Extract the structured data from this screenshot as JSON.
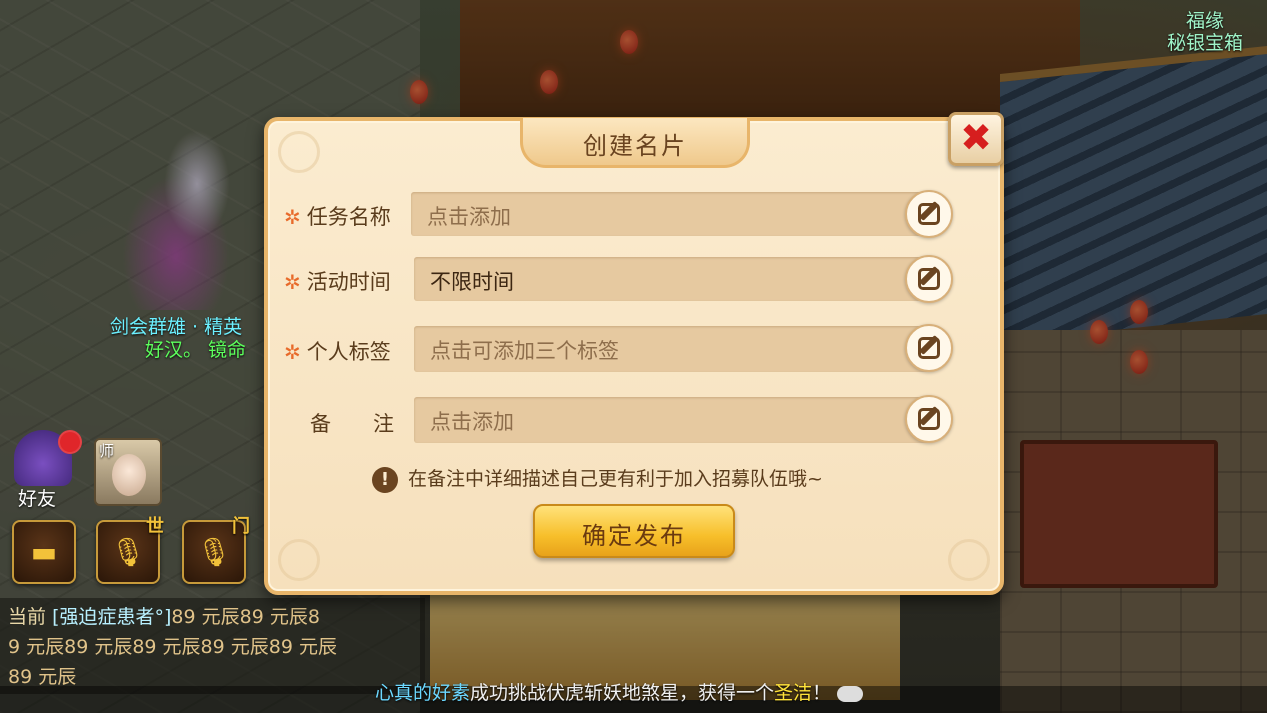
{
  "hud": {
    "top_right_line1": "福缘",
    "top_right_line2": "秘银宝箱",
    "player_name": "剑会群雄 · 精英",
    "player_title": "好汉。 镜命",
    "friend_label": "好友",
    "master_label": "师",
    "world_voice_tag": "世",
    "team_voice_tag": "门"
  },
  "chat": {
    "channel": "当前",
    "sender": "[强迫症患者°]",
    "line1_tail": "89 元辰89 元辰8",
    "line2": "9 元辰89 元辰89 元辰89 元辰89 元辰",
    "line3": "89 元辰"
  },
  "system_message": {
    "name": "心真的好素",
    "text": "成功挑战伏虎斩妖地煞星，获得一个",
    "item": "圣洁",
    "tail": "！"
  },
  "dialog": {
    "title": "创建名片",
    "close_symbol": "✖",
    "fields": [
      {
        "label": "任务名称",
        "required": true,
        "placeholder": "点击添加",
        "value": ""
      },
      {
        "label": "活动时间",
        "required": true,
        "placeholder": "",
        "value": "不限时间"
      },
      {
        "label": "个人标签",
        "required": true,
        "placeholder": "点击可添加三个标签",
        "value": ""
      },
      {
        "label": "备　　注",
        "required": false,
        "placeholder": "点击添加",
        "value": ""
      }
    ],
    "required_mark": "✲",
    "hint_icon": "!",
    "hint": "在备注中详细描述自己更有利于加入招募队伍哦~",
    "confirm_label": "确定发布"
  },
  "colors": {
    "dialog_bg": "#fbecd0",
    "field_bg": "#e6c9a0",
    "accent_star": "#e86a2a",
    "close_red": "#d61e1e",
    "confirm_gold": "#f7bf2a"
  },
  "icons": {
    "close": "close-icon",
    "edit": "edit-icon",
    "hint": "exclamation-icon",
    "chat": "chat-bubble-icon",
    "voice": "microphone-icon"
  }
}
